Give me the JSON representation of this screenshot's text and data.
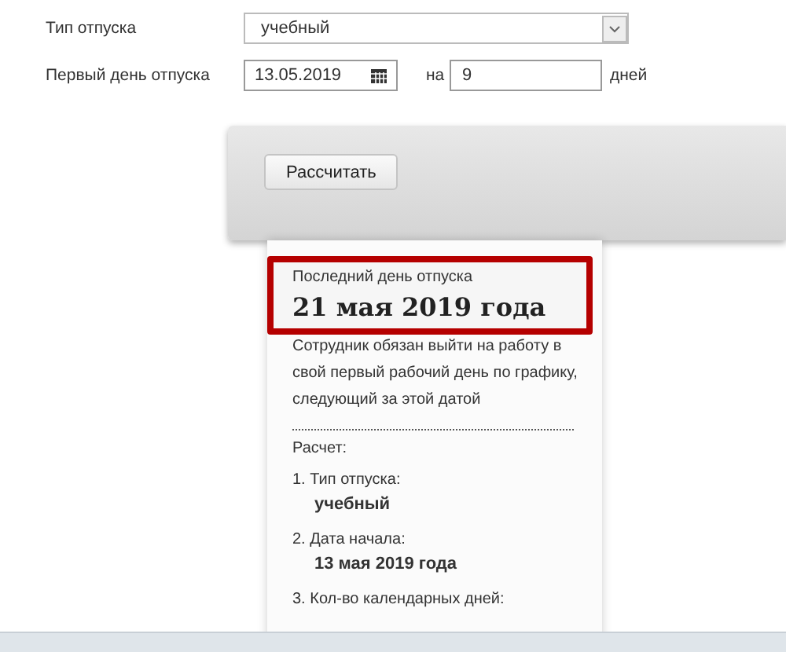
{
  "form": {
    "rows": [
      {
        "kind": "select",
        "label": "Тип отпуска",
        "value": "учебный"
      },
      {
        "kind": "date",
        "label": "Первый день отпуска",
        "value": "13.05.2019",
        "joiner": "на",
        "count": "9",
        "unit": "дней"
      }
    ]
  },
  "calculate_button": "Рассчитать",
  "result": {
    "caption": "Последний день отпуска",
    "date": "21 мая 2019 года",
    "note": "Сотрудник обязан выйти на работу в свой первый рабочий день по графику, следующий за этой датой",
    "calc_title": "Расчет:",
    "steps": [
      {
        "number": "1.",
        "label": "Тип отпуска:",
        "value": "учебный"
      },
      {
        "number": "2.",
        "label": "Дата начала:",
        "value": "13 мая 2019 года"
      },
      {
        "number": "3.",
        "label": "Кол-во календарных дней:"
      }
    ]
  }
}
